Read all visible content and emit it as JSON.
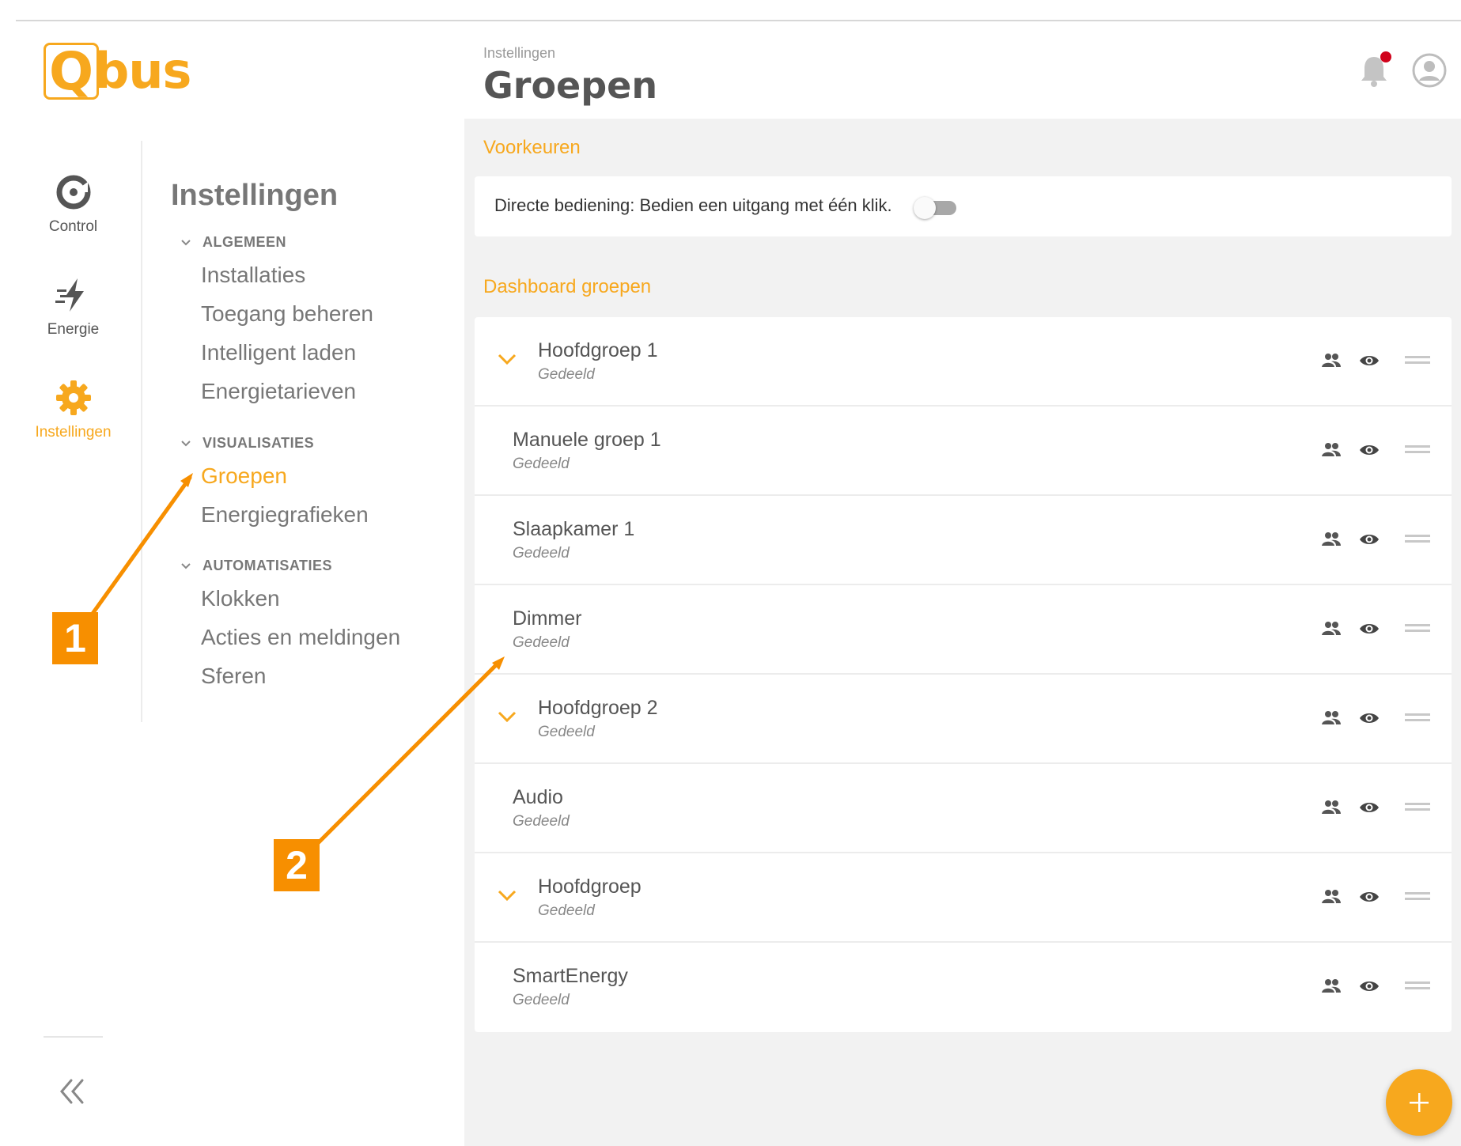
{
  "app": {
    "logo_text": "bus",
    "logo_letter": "Q"
  },
  "rail": {
    "items": [
      {
        "label": "Control",
        "icon": "control-icon",
        "active": false
      },
      {
        "label": "Energie",
        "icon": "energy-icon",
        "active": false
      },
      {
        "label": "Instellingen",
        "icon": "gear-icon",
        "active": true
      }
    ]
  },
  "settings_nav": {
    "title": "Instellingen",
    "sections": [
      {
        "label": "ALGEMEEN",
        "items": [
          "Installaties",
          "Toegang beheren",
          "Intelligent laden",
          "Energietarieven"
        ]
      },
      {
        "label": "VISUALISATIES",
        "items": [
          "Groepen",
          "Energiegrafieken"
        ]
      },
      {
        "label": "AUTOMATISATIES",
        "items": [
          "Klokken",
          "Acties en meldingen",
          "Sferen"
        ]
      }
    ],
    "active_item": "Groepen"
  },
  "header": {
    "breadcrumb": "Instellingen",
    "title": "Groepen"
  },
  "preferences": {
    "section_title": "Voorkeuren",
    "direct_control_label": "Directe bediening: Bedien een uitgang met één klik.",
    "direct_control_enabled": false
  },
  "dashboard_groups": {
    "section_title": "Dashboard groepen",
    "rows": [
      {
        "name": "Hoofdgroep 1",
        "status": "Gedeeld",
        "type": "parent"
      },
      {
        "name": "Manuele groep 1",
        "status": "Gedeeld",
        "type": "child"
      },
      {
        "name": "Slaapkamer 1",
        "status": "Gedeeld",
        "type": "child"
      },
      {
        "name": "Dimmer",
        "status": "Gedeeld",
        "type": "child"
      },
      {
        "name": "Hoofdgroep 2",
        "status": "Gedeeld",
        "type": "parent"
      },
      {
        "name": "Audio",
        "status": "Gedeeld",
        "type": "child"
      },
      {
        "name": "Hoofdgroep",
        "status": "Gedeeld",
        "type": "parent"
      },
      {
        "name": "SmartEnergy",
        "status": "Gedeeld",
        "type": "child"
      }
    ]
  },
  "callouts": [
    {
      "label": "1"
    },
    {
      "label": "2"
    }
  ],
  "colors": {
    "accent": "#f7a81e",
    "callout": "#f78f00",
    "notification_dot": "#d0021b",
    "text": "#555555",
    "panel_bg": "#f2f2f2"
  }
}
